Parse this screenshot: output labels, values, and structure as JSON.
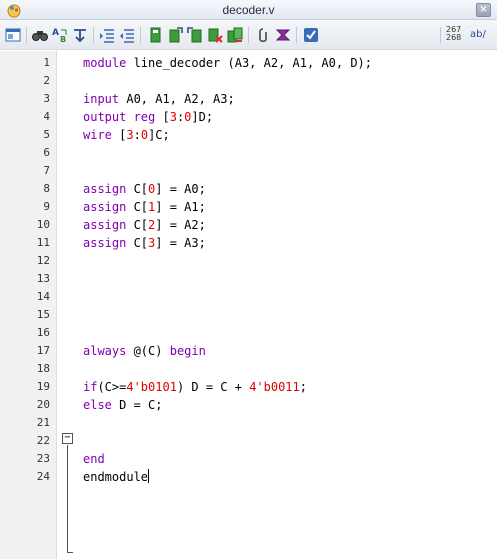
{
  "window": {
    "title": "decoder.v",
    "close_glyph": "×"
  },
  "toolbar": {
    "items": [
      "window-icon",
      "find-icon",
      "replace-icon",
      "goto-icon",
      "indent-icon",
      "outdent-icon",
      "bookmark-icon",
      "next-bookmark-icon",
      "prev-bookmark-icon",
      "clear-bookmark-icon",
      "bookmarks-list-icon",
      "attach-icon",
      "macro-icon",
      "check-icon"
    ],
    "line_count_top": "267",
    "line_count_bottom": "268",
    "wrap_label": "ab/"
  },
  "editor": {
    "line_numbers": [
      "1",
      "2",
      "3",
      "4",
      "5",
      "6",
      "7",
      "8",
      "9",
      "10",
      "11",
      "12",
      "13",
      "14",
      "15",
      "16",
      "17",
      "18",
      "19",
      "20",
      "21",
      "22",
      "23",
      "24"
    ],
    "fold_glyph": "−",
    "colors": {
      "keyword": "#8000b0",
      "number": "#e00000",
      "text": "#000000"
    },
    "lines": [
      [
        {
          "c": "kw",
          "t": "module"
        },
        {
          "c": "txt",
          "t": " line_decoder (A3, A2, A1, A0, D);"
        }
      ],
      [],
      [
        {
          "c": "kw",
          "t": "input"
        },
        {
          "c": "txt",
          "t": " A0, A1, A2, A3;"
        }
      ],
      [
        {
          "c": "kw",
          "t": "output reg"
        },
        {
          "c": "txt",
          "t": " ["
        },
        {
          "c": "num",
          "t": "3"
        },
        {
          "c": "txt",
          "t": ":"
        },
        {
          "c": "num",
          "t": "0"
        },
        {
          "c": "txt",
          "t": "]D;"
        }
      ],
      [
        {
          "c": "kw",
          "t": "wire"
        },
        {
          "c": "txt",
          "t": " ["
        },
        {
          "c": "num",
          "t": "3"
        },
        {
          "c": "txt",
          "t": ":"
        },
        {
          "c": "num",
          "t": "0"
        },
        {
          "c": "txt",
          "t": "]C;"
        }
      ],
      [],
      [],
      [
        {
          "c": "kw",
          "t": "assign"
        },
        {
          "c": "txt",
          "t": " C["
        },
        {
          "c": "num",
          "t": "0"
        },
        {
          "c": "txt",
          "t": "] = A0;"
        }
      ],
      [
        {
          "c": "kw",
          "t": "assign"
        },
        {
          "c": "txt",
          "t": " C["
        },
        {
          "c": "num",
          "t": "1"
        },
        {
          "c": "txt",
          "t": "] = A1;"
        }
      ],
      [
        {
          "c": "kw",
          "t": "assign"
        },
        {
          "c": "txt",
          "t": " C["
        },
        {
          "c": "num",
          "t": "2"
        },
        {
          "c": "txt",
          "t": "] = A2;"
        }
      ],
      [
        {
          "c": "kw",
          "t": "assign"
        },
        {
          "c": "txt",
          "t": " C["
        },
        {
          "c": "num",
          "t": "3"
        },
        {
          "c": "txt",
          "t": "] = A3;"
        }
      ],
      [],
      [],
      [],
      [],
      [],
      [
        {
          "c": "kw",
          "t": "always"
        },
        {
          "c": "txt",
          "t": " @(C) "
        },
        {
          "c": "kw",
          "t": "begin"
        }
      ],
      [],
      [
        {
          "c": "kw",
          "t": "if"
        },
        {
          "c": "txt",
          "t": "(C>="
        },
        {
          "c": "num",
          "t": "4'b0101"
        },
        {
          "c": "txt",
          "t": ") D = C + "
        },
        {
          "c": "num",
          "t": "4'b0011"
        },
        {
          "c": "txt",
          "t": ";"
        }
      ],
      [
        {
          "c": "kw",
          "t": "else"
        },
        {
          "c": "txt",
          "t": " D = C;"
        }
      ],
      [],
      [],
      [
        {
          "c": "kw",
          "t": "end"
        }
      ],
      [
        {
          "c": "txt",
          "t": "endmodule"
        }
      ]
    ]
  }
}
